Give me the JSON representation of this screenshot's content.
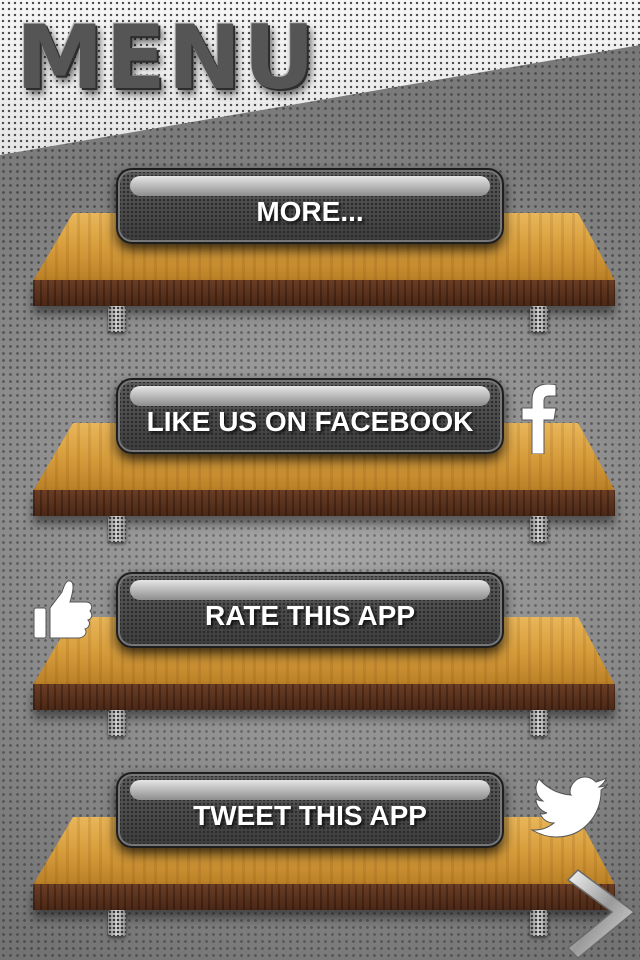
{
  "header": {
    "title": "MENU"
  },
  "menu": {
    "items": [
      {
        "label": "MORE...",
        "icon": "none"
      },
      {
        "label": "LIKE US ON FACEBOOK",
        "icon": "facebook-icon"
      },
      {
        "label": "RATE THIS APP",
        "icon": "thumbs-up-icon"
      },
      {
        "label": "TWEET THIS APP",
        "icon": "twitter-bird-icon"
      }
    ]
  },
  "nav": {
    "next_icon": "chevron-right-icon"
  },
  "colors": {
    "button_text": "#ffffff",
    "wood_top": "#d79d3c",
    "wood_front": "#4a2716",
    "background": "#8c8c8c"
  }
}
